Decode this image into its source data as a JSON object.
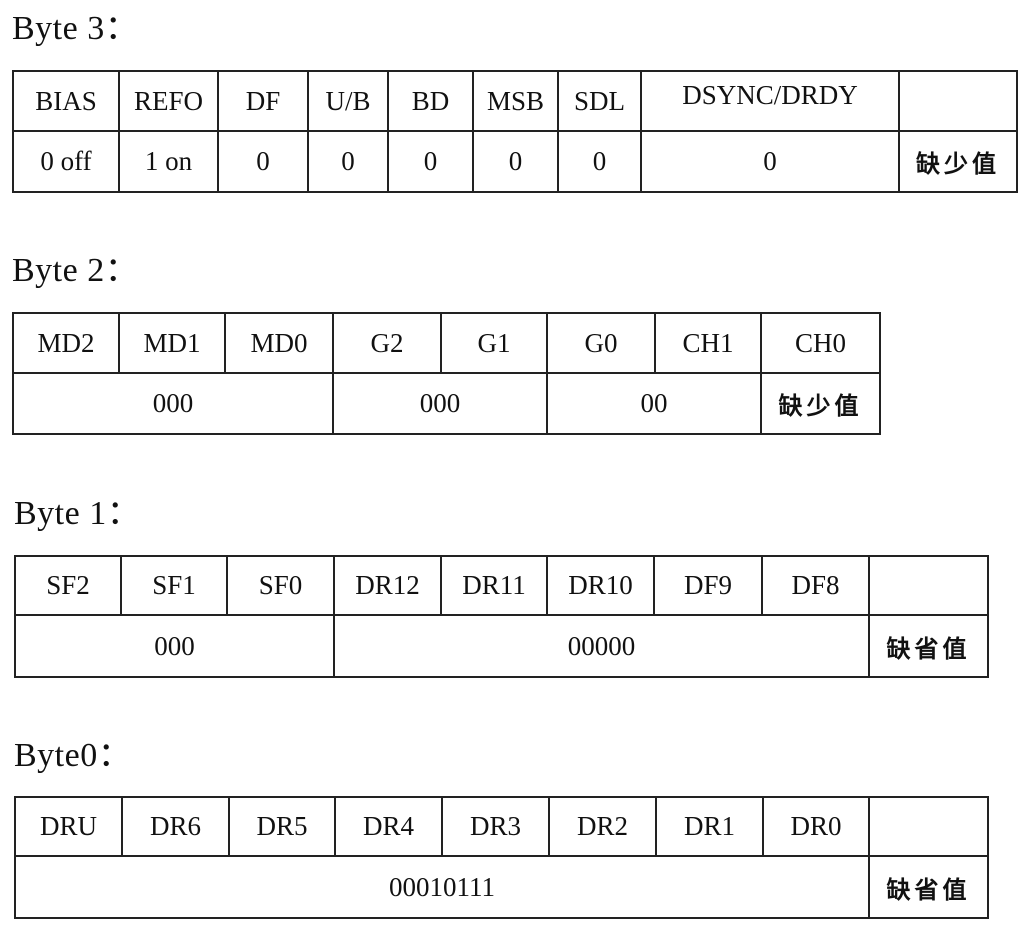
{
  "bytes": [
    {
      "title": "Byte 3：",
      "fields": [
        "BIAS",
        "REFO",
        "DF",
        "U/B",
        "BD",
        "MSB",
        "SDL",
        "DSYNC/DRDY",
        ""
      ],
      "values": [
        "0 off",
        "1 on",
        "0",
        "0",
        "0",
        "0",
        "0",
        "0",
        "缺少值"
      ]
    },
    {
      "title": "Byte 2：",
      "fields": [
        "MD2",
        "MD1",
        "MD0",
        "G2",
        "G1",
        "G0",
        "CH1",
        "CH0"
      ],
      "values": [
        "000",
        "000",
        "00",
        "缺少值"
      ]
    },
    {
      "title": "Byte 1：",
      "fields": [
        "SF2",
        "SF1",
        "SF0",
        "DR12",
        "DR11",
        "DR10",
        "DF9",
        "DF8",
        ""
      ],
      "values": [
        "000",
        "00000",
        "缺省值"
      ]
    },
    {
      "title": "Byte0：",
      "fields": [
        "DRU",
        "DR6",
        "DR5",
        "DR4",
        "DR3",
        "DR2",
        "DR1",
        "DR0",
        ""
      ],
      "values": [
        "00010111",
        "缺省值"
      ]
    }
  ]
}
